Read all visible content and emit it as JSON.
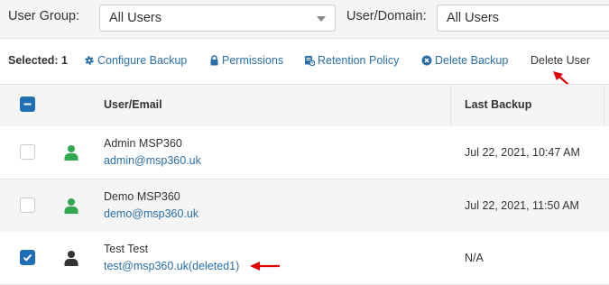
{
  "filters": {
    "user_group_label": "User Group:",
    "user_group_value": "All Users",
    "user_domain_label": "User/Domain:",
    "user_domain_value": "All Users"
  },
  "toolbar": {
    "selected": "Selected: 1",
    "configure_backup": "Configure Backup",
    "permissions": "Permissions",
    "retention_policy": "Retention Policy",
    "delete_backup": "Delete Backup",
    "delete_user": "Delete User"
  },
  "table": {
    "col_user": "User/Email",
    "col_last_backup": "Last Backup",
    "rows": [
      {
        "name": "Admin MSP360",
        "email": "admin@msp360.uk",
        "last_backup": "Jul 22, 2021, 10:47 AM",
        "checked": false,
        "avatar_color": "#2fa84f"
      },
      {
        "name": "Demo MSP360",
        "email": "demo@msp360.uk",
        "last_backup": "Jul 22, 2021, 11:50 AM",
        "checked": false,
        "avatar_color": "#2fa84f"
      },
      {
        "name": "Test Test",
        "email": "test@msp360.uk(deleted1)",
        "last_backup": "N/A",
        "checked": true,
        "avatar_color": "#333333"
      }
    ]
  },
  "colors": {
    "accent": "#1f6fb5",
    "link": "#2a6fa8",
    "annotation_arrow": "#e00000"
  }
}
